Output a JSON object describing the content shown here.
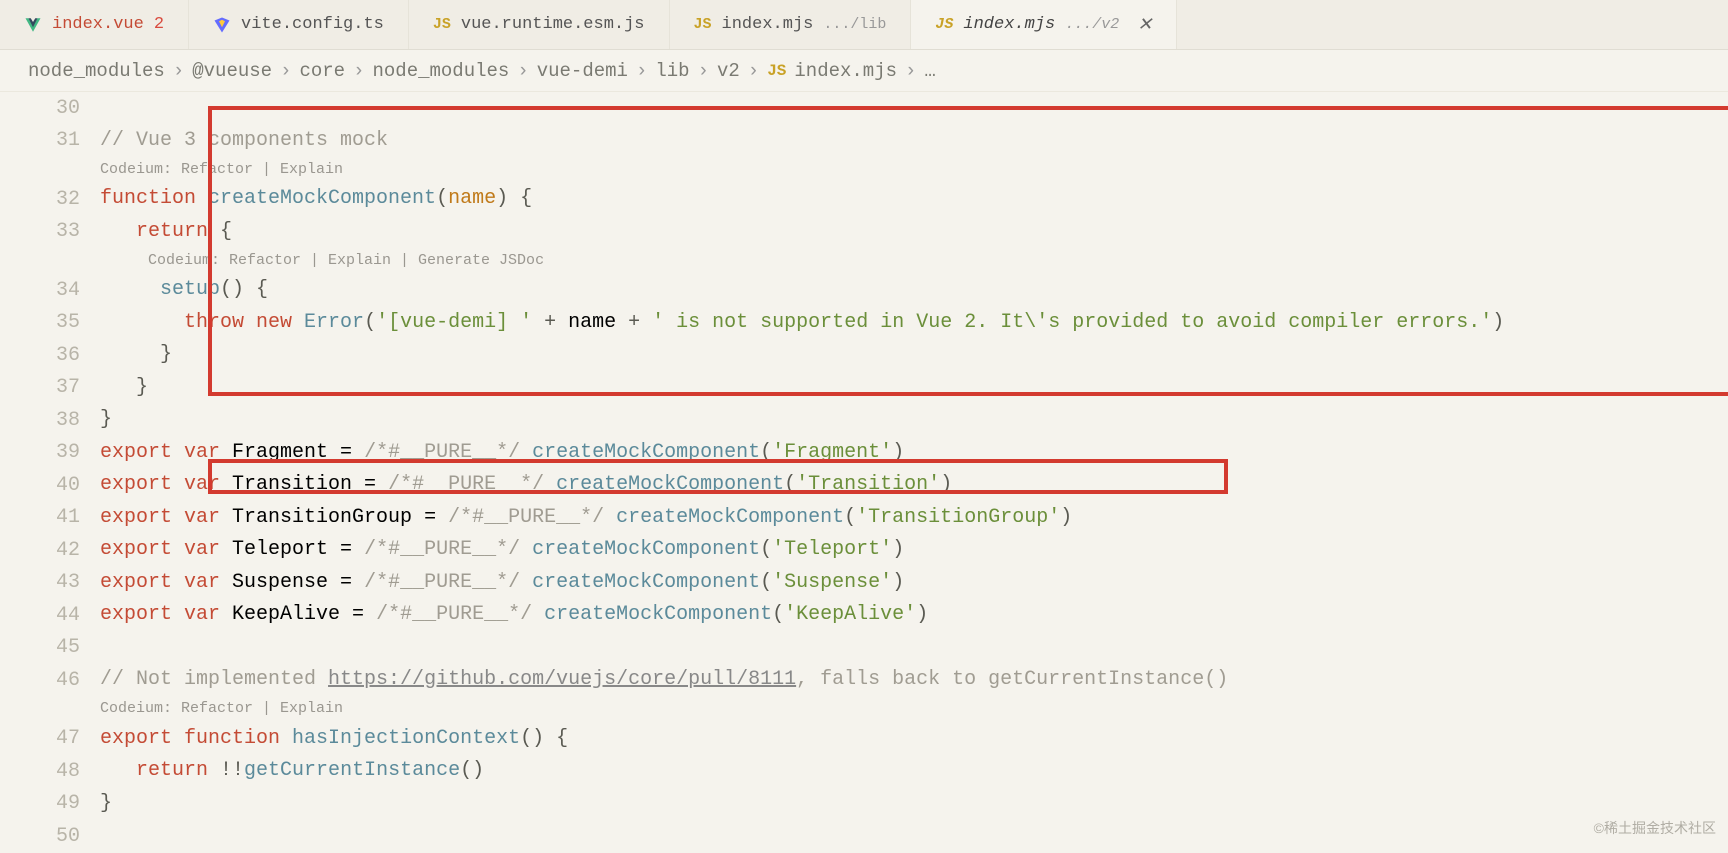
{
  "tabs": [
    {
      "icon": "vue",
      "label": "index.vue",
      "badge": "2",
      "active": false
    },
    {
      "icon": "vite",
      "label": "vite.config.ts",
      "active": false
    },
    {
      "icon": "js",
      "label": "vue.runtime.esm.js",
      "active": false
    },
    {
      "icon": "js",
      "label": "index.mjs",
      "suffix": ".../lib",
      "active": false
    },
    {
      "icon": "js",
      "label": "index.mjs",
      "suffix": ".../v2",
      "active": true,
      "closeable": true
    }
  ],
  "breadcrumb": {
    "segments": [
      "node_modules",
      "@vueuse",
      "core",
      "node_modules",
      "vue-demi",
      "lib",
      "v2"
    ],
    "js_tag": "JS",
    "file": "index.mjs",
    "trailing": "…"
  },
  "gutter": {
    "start": 30,
    "end": 50
  },
  "codeium_hints": {
    "h1": "Codeium: Refactor | Explain",
    "h2": "Codeium: Refactor | Explain | Generate JSDoc",
    "h3": "Codeium: Refactor | Explain"
  },
  "code": {
    "l31_comment": "// Vue 3 components mock",
    "l32_kw1": "function",
    "l32_fn": " createMockComponent",
    "l32_paren_open": "(",
    "l32_param": "name",
    "l32_paren_close": ") ",
    "l32_brace": "{",
    "l33_pad": "   ",
    "l33_kw": "return",
    "l33_rest": " {",
    "l34_pad": "     ",
    "l34_fn": "setup",
    "l34_rest": "() {",
    "l35_pad": "       ",
    "l35_kw1": "throw",
    "l35_kw2": " new",
    "l35_fn": " Error",
    "l35_op1": "(",
    "l35_str1": "'[vue-demi] '",
    "l35_op2": " + ",
    "l35_id": "name",
    "l35_op3": " + ",
    "l35_str2": "' is not supported in Vue 2. It\\'s provided to avoid compiler errors.'",
    "l35_op4": ")",
    "l36_pad": "     ",
    "l36_brace": "}",
    "l37_pad": "   ",
    "l37_brace": "}",
    "l38_brace": "}",
    "l39_kw1": "export",
    "l39_kw2": " var",
    "l39_id": " Fragment = ",
    "l39_c": "/*#__PURE__*/ ",
    "l39_fn": "createMockComponent",
    "l39_op1": "(",
    "l39_str": "'Fragment'",
    "l39_op2": ")",
    "l40_kw1": "export",
    "l40_kw2": " var",
    "l40_id": " Transition = ",
    "l40_c": "/*#__PURE__*/ ",
    "l40_fn": "createMockComponent",
    "l40_op1": "(",
    "l40_str": "'Transition'",
    "l40_op2": ")",
    "l41_kw1": "export",
    "l41_kw2": " var",
    "l41_id": " TransitionGroup = ",
    "l41_c": "/*#__PURE__*/ ",
    "l41_fn": "createMockComponent",
    "l41_op1": "(",
    "l41_str": "'TransitionGroup'",
    "l41_op2": ")",
    "l42_kw1": "export",
    "l42_kw2": " var",
    "l42_id": " Teleport = ",
    "l42_c": "/*#__PURE__*/ ",
    "l42_fn": "createMockComponent",
    "l42_op1": "(",
    "l42_str": "'Teleport'",
    "l42_op2": ")",
    "l43_kw1": "export",
    "l43_kw2": " var",
    "l43_id": " Suspense = ",
    "l43_c": "/*#__PURE__*/ ",
    "l43_fn": "createMockComponent",
    "l43_op1": "(",
    "l43_str": "'Suspense'",
    "l43_op2": ")",
    "l44_kw1": "export",
    "l44_kw2": " var",
    "l44_id": " KeepAlive = ",
    "l44_c": "/*#__PURE__*/ ",
    "l44_fn": "createMockComponent",
    "l44_op1": "(",
    "l44_str": "'KeepAlive'",
    "l44_op2": ")",
    "l46_c1": "// Not implemented ",
    "l46_link": "https://github.com/vuejs/core/pull/8111",
    "l46_c2": ", falls back to getCurrentInstance()",
    "l47_kw1": "export",
    "l47_kw2": " function",
    "l47_fn": " hasInjectionContext",
    "l47_rest": "() {",
    "l48_pad": "   ",
    "l48_kw": "return",
    "l48_op": " !!",
    "l48_fn": "getCurrentInstance",
    "l48_rest": "()",
    "l49_brace": "}"
  },
  "watermark": "©稀土掘金技术社区"
}
